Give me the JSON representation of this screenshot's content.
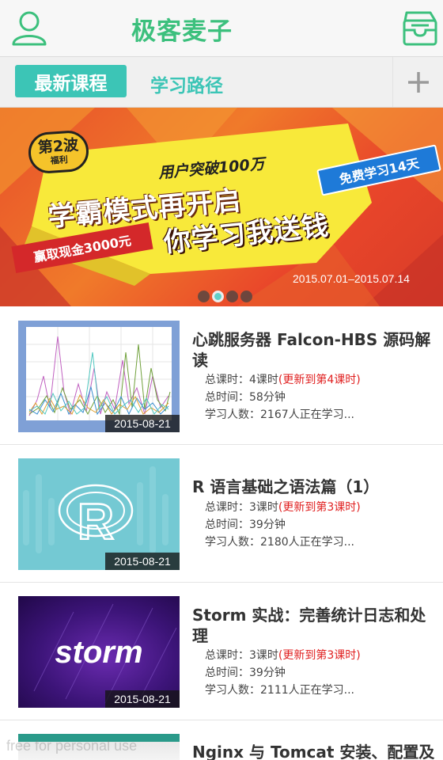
{
  "header": {
    "title": "极客麦子",
    "icons": {
      "left": "user-icon",
      "right": "inbox-icon"
    },
    "accent": "#3cc07d"
  },
  "tabs": {
    "active": "最新课程",
    "second": "学习路径",
    "add_icon": "plus-icon",
    "accent": "#3cc5b6"
  },
  "banner": {
    "badge_line1": "第2波",
    "badge_line2": "福利",
    "subtitle": "用户突破100万",
    "main_line1": "学霸模式再开启",
    "main_line2": "你学习我送钱",
    "blue_tag": "免费学习14天",
    "red_tag": "赢取现金3000元",
    "date_range": "2015.07.01–2015.07.14",
    "pages": 4,
    "current_page": 2
  },
  "courses": [
    {
      "title": "心跳服务器 Falcon-HBS 源码解读",
      "date": "2015-08-21",
      "lessons_label": "总课时：4课时",
      "update_label": "(更新到第4课时)",
      "duration_label": "总时间：58分钟",
      "learners_label": "学习人数：2167人正在学习..."
    },
    {
      "title": "R 语言基础之语法篇（1）",
      "date": "2015-08-21",
      "lessons_label": "总课时：3课时",
      "update_label": "(更新到第3课时)",
      "duration_label": "总时间：39分钟",
      "learners_label": "学习人数：2180人正在学习..."
    },
    {
      "title": "Storm 实战：完善统计日志和处理",
      "date": "2015-08-21",
      "lessons_label": "总课时：3课时",
      "update_label": "(更新到第3课时)",
      "duration_label": "总时间：39分钟",
      "learners_label": "学习人数：2111人正在学习..."
    },
    {
      "title": "Nginx 与 Tomcat 安装、配置及"
    }
  ],
  "thumb_labels": {
    "storm": "storm",
    "r": "R"
  },
  "watermark": "free for personal use"
}
